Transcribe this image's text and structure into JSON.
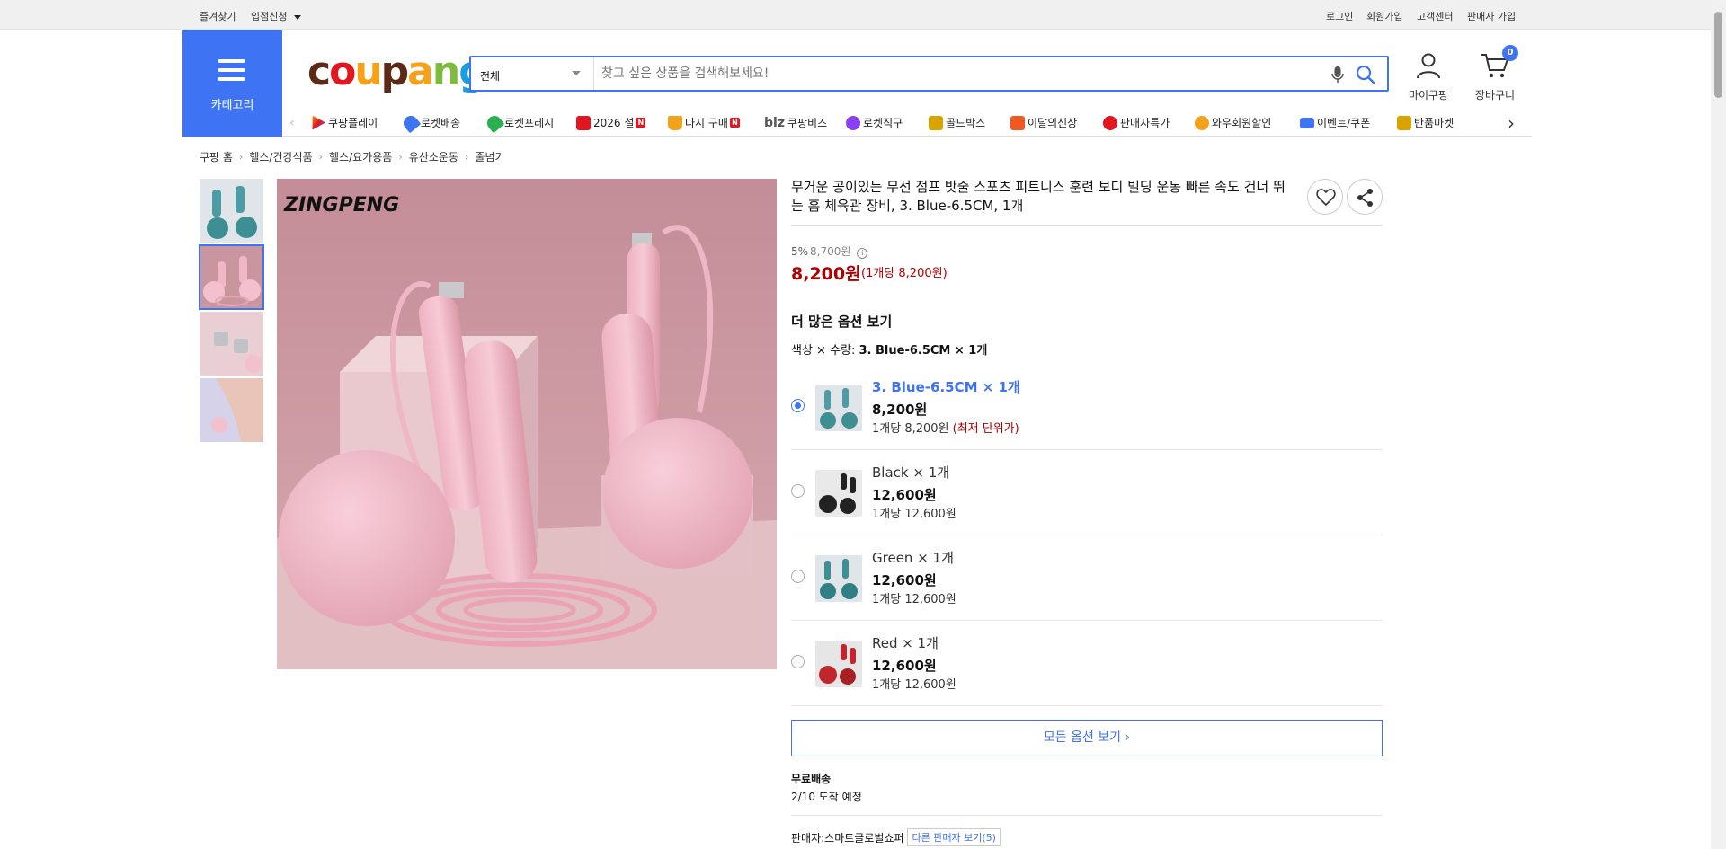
{
  "topbar": {
    "left": [
      "즐겨찾기",
      "입점신청"
    ],
    "right": [
      "로그인",
      "회원가입",
      "고객센터",
      "판매자 가입"
    ]
  },
  "header": {
    "category_label": "카테고리",
    "logo_text": "coupang",
    "search": {
      "category": "전체",
      "placeholder": "찾고 싶은 상품을 검색해보세요!"
    },
    "mypage_label": "마이쿠팡",
    "cart_label": "장바구니",
    "cart_count": "0",
    "accent_color": "#3e74f4"
  },
  "nav": {
    "items": [
      {
        "label": "쿠팡플레이",
        "icon": "play-icon",
        "color": "#f0a"
      },
      {
        "label": "로켓배송",
        "icon": "rocket-icon",
        "color": "#3e74f4"
      },
      {
        "label": "로켓프레시",
        "icon": "rocket-fresh-icon",
        "color": "#2ab050"
      },
      {
        "label": "2026 설",
        "icon": "gift-icon",
        "color": "#e2161e",
        "badge": "N"
      },
      {
        "label": "다시 구매",
        "icon": "basket-icon",
        "color": "#f5a11a",
        "badge": "N"
      },
      {
        "label": "쿠팡비즈",
        "icon": "biz-icon",
        "color": "#111",
        "prefix": "biz"
      },
      {
        "label": "로켓직구",
        "icon": "global-icon",
        "color": "#8a3ff0"
      },
      {
        "label": "골드박스",
        "icon": "goldbox-icon",
        "color": "#d9a400"
      },
      {
        "label": "이달의신상",
        "icon": "new-icon",
        "color": "#f05a22"
      },
      {
        "label": "판매자특가",
        "icon": "percent-icon",
        "color": "#e2161e"
      },
      {
        "label": "와우회원할인",
        "icon": "wow-icon",
        "color": "#f5a11a"
      },
      {
        "label": "이벤트/쿠폰",
        "icon": "coupon-icon",
        "color": "#3e74f4"
      },
      {
        "label": "반품마켓",
        "icon": "market-icon",
        "color": "#d9a400"
      }
    ]
  },
  "breadcrumb": [
    "쿠팡 홈",
    "헬스/건강식품",
    "헬스/요가용품",
    "유산소운동",
    "줄넘기"
  ],
  "product": {
    "brand_mark": "ZINGPENG",
    "title": "무거운 공이있는 무선 점프 밧줄 스포츠 피트니스 훈련 보디 빌딩 운동 빠른 속도 건너 뛰는 홈 체육관 장비, 3. Blue-6.5CM, 1개",
    "discount_rate": "5%",
    "original_price": "8,700원",
    "price": "8,200원",
    "unit_price": "(1개당 8,200원)",
    "more_options_title": "더 많은 옵션 보기",
    "selected_label": "색상 × 수량: ",
    "selected_value": "3. Blue-6.5CM × 1개",
    "options": [
      {
        "name": "3. Blue-6.5CM × 1개",
        "price": "8,200원",
        "unit": "1개당 8,200원",
        "note": "(최저 단위가)",
        "selected": true,
        "color": "#4e9aa5"
      },
      {
        "name": "Black × 1개",
        "price": "12,600원",
        "unit": "1개당 12,600원",
        "note": "",
        "selected": false,
        "color": "#222222"
      },
      {
        "name": "Green × 1개",
        "price": "12,600원",
        "unit": "1개당 12,600원",
        "note": "",
        "selected": false,
        "color": "#3e8f94"
      },
      {
        "name": "Red × 1개",
        "price": "12,600원",
        "unit": "1개당 12,600원",
        "note": "",
        "selected": false,
        "color": "#c0262c"
      }
    ],
    "all_options_label": "모든 옵션 보기 ›",
    "shipping_title": "무료배송",
    "shipping_eta": "2/10 도착 예정",
    "seller_label": "판매자:스마트글로벌쇼퍼",
    "other_sellers": "다른 판매자 보기(5)",
    "sale_color": "#ae0000"
  }
}
